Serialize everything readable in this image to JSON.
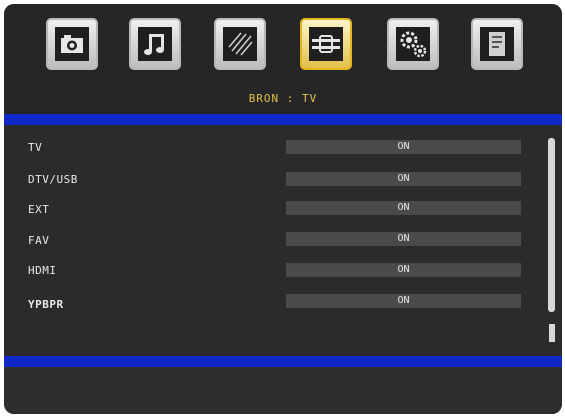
{
  "menu": {
    "icons": [
      {
        "name": "picture-icon"
      },
      {
        "name": "sound-icon"
      },
      {
        "name": "channel-icon"
      },
      {
        "name": "source-icon",
        "selected": true
      },
      {
        "name": "setup-icon"
      },
      {
        "name": "feature-icon"
      }
    ],
    "source_label": "BRON : TV"
  },
  "list": {
    "rows": [
      {
        "label": "TV",
        "value": "ON"
      },
      {
        "label": "DTV/USB",
        "value": "ON"
      },
      {
        "label": "EXT",
        "value": "ON"
      },
      {
        "label": "FAV",
        "value": "ON"
      },
      {
        "label": "HDMI",
        "value": "ON"
      },
      {
        "label": "YPBPR",
        "value": "ON"
      }
    ]
  },
  "colors": {
    "accent_bar": "#1128c8",
    "selected_icon": "#e6b420",
    "label_text": "#e0c24a"
  }
}
